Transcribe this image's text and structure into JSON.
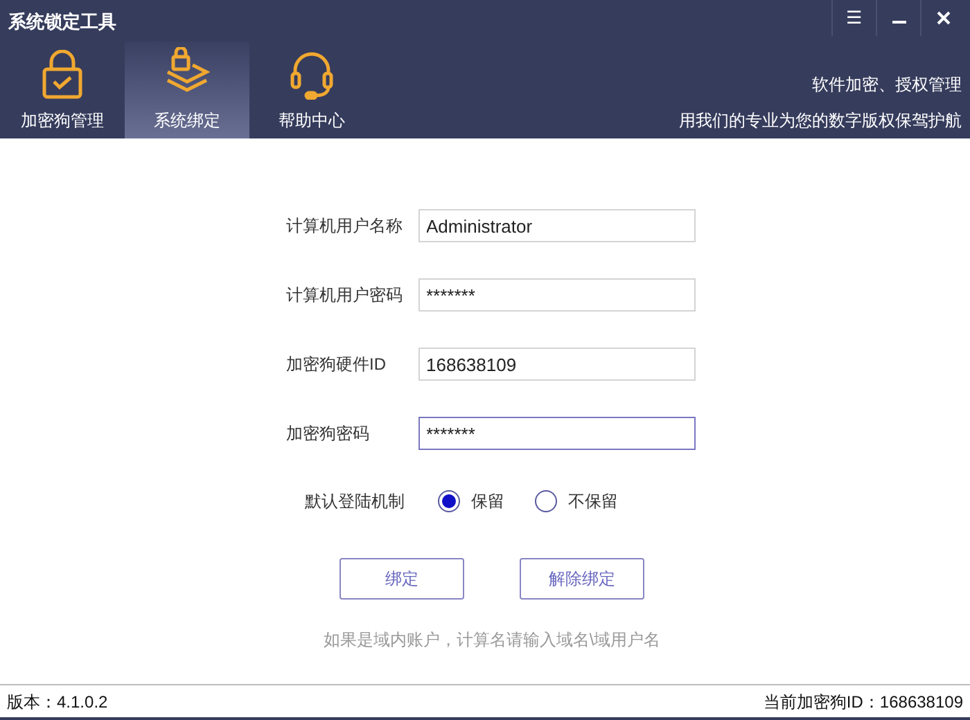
{
  "window": {
    "title": "系统锁定工具",
    "controls": [
      {
        "kind": "menu",
        "label": "☰"
      },
      {
        "kind": "minimize"
      },
      {
        "kind": "close"
      }
    ]
  },
  "tabs": [
    {
      "label": "加密狗管理",
      "kind": "lock",
      "selected": false
    },
    {
      "label": "系统绑定",
      "kind": "layers",
      "selected": true
    },
    {
      "label": "帮助中心",
      "kind": "headset",
      "selected": false
    }
  ],
  "slogan": [
    "软件加密、授权管理",
    "用我们的专业为您的数字版权保驾护航"
  ],
  "fields": [
    {
      "label": "计算机用户名称",
      "value": "Administrator",
      "focused": false
    },
    {
      "label": "计算机用户密码",
      "value": "*******",
      "focused": false
    },
    {
      "label": "加密狗硬件ID",
      "value": "168638109",
      "focused": false
    },
    {
      "label": "加密狗密码",
      "value": "*******",
      "focused": true
    }
  ],
  "login_mode": {
    "label": "默认登陆机制",
    "options": [
      {
        "label": "保留",
        "selected": true
      },
      {
        "label": "不保留",
        "selected": false
      }
    ]
  },
  "buttons": [
    "绑定",
    "解除绑定"
  ],
  "hint": "如果是域内账户，计算名请输入域名\\域用户名",
  "status_bar": {
    "version": "版本：4.1.0.2",
    "dongle_id": "当前加密狗ID：168638109"
  }
}
